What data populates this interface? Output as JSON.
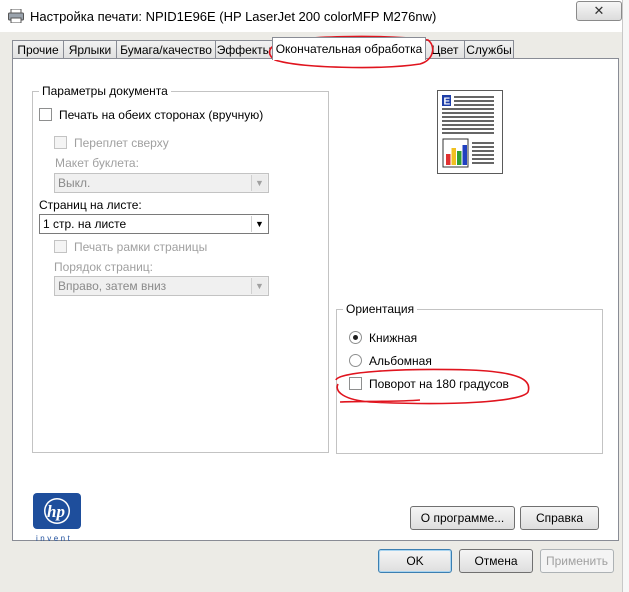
{
  "window": {
    "title": "Настройка печати: NPID1E96E (HP LaserJet 200 colorMFP M276nw)",
    "close_label": "✕"
  },
  "tabs": [
    {
      "label": "Прочие",
      "active": false
    },
    {
      "label": "Ярлыки",
      "active": false
    },
    {
      "label": "Бумага/качество",
      "active": false
    },
    {
      "label": "Эффекты",
      "active": false
    },
    {
      "label": "Окончательная обработка",
      "active": true
    },
    {
      "label": "Цвет",
      "active": false
    },
    {
      "label": "Службы",
      "active": false
    }
  ],
  "document_options": {
    "legend": "Параметры документа",
    "duplex_label": "Печать на обеих сторонах (вручную)",
    "flip_label": "Переплет сверху",
    "booklet_label": "Макет буклета:",
    "booklet_value": "Выкл.",
    "pages_per_sheet_label": "Страниц на листе:",
    "pages_per_sheet_value": "1 стр. на листе",
    "borders_label": "Печать рамки страницы",
    "order_label": "Порядок страниц:",
    "order_value": "Вправо, затем вниз"
  },
  "preview": {
    "letter": "E",
    "bar_colors": [
      "#e03030",
      "#f0c020",
      "#30a030",
      "#2040c0"
    ],
    "bar_levels": [
      0.55,
      0.85,
      0.7,
      1.0
    ]
  },
  "orientation": {
    "legend": "Ориентация",
    "portrait_label": "Книжная",
    "landscape_label": "Альбомная",
    "rotate_label": "Поворот на 180 градусов",
    "selected": "portrait"
  },
  "logo": {
    "brand": "hp",
    "tagline": "invent",
    "color": "#1e4e9c"
  },
  "buttons": {
    "about": "О программе...",
    "help": "Справка",
    "ok": "OK",
    "cancel": "Отмена",
    "apply": "Применить"
  },
  "annotation_color": "#e0141e"
}
